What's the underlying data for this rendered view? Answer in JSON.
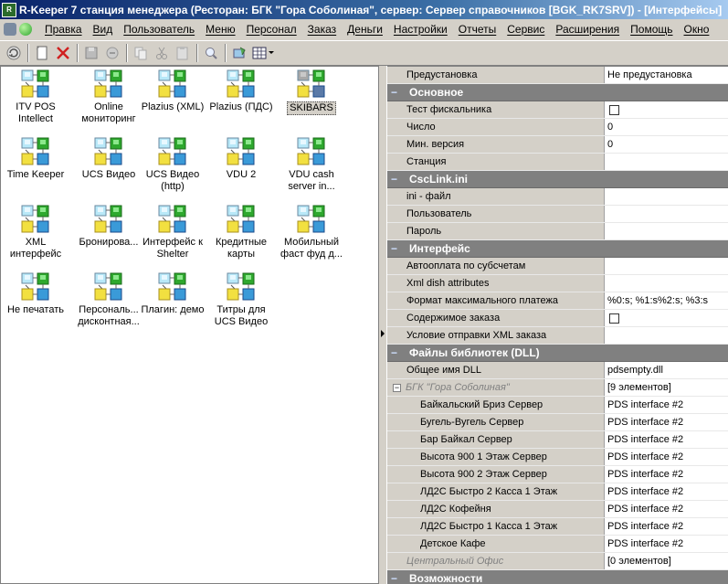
{
  "window": {
    "title": "R-Keeper 7 станция менеджера (Ресторан: БГК \"Гора Соболиная\", сервер: Сервер справочников [BGK_RK7SRV]) - [Интерфейсы]"
  },
  "menu": [
    "Правка",
    "Вид",
    "Пользователь",
    "Меню",
    "Персонал",
    "Заказ",
    "Деньги",
    "Настройки",
    "Отчеты",
    "Сервис",
    "Расширения",
    "Помощь",
    "Окно"
  ],
  "toolbar": {
    "buttons": [
      "refresh-icon",
      "new-document-icon",
      "delete-icon",
      "save-icon",
      "undo-icon",
      "copy-icon",
      "cut-icon",
      "paste-icon",
      "search-icon",
      "properties-icon",
      "grid-view-icon"
    ]
  },
  "interfaces": [
    {
      "label": "ITV POS Intellect"
    },
    {
      "label": "Online мониторинг"
    },
    {
      "label": "Plazius (XML)"
    },
    {
      "label": "Plazius (ПДС)"
    },
    {
      "label": "SKIBARS",
      "selected": true
    },
    {
      "label": "Time Keeper"
    },
    {
      "label": "UCS Видео"
    },
    {
      "label": "UCS Видео (http)"
    },
    {
      "label": "VDU 2"
    },
    {
      "label": "VDU cash server in..."
    },
    {
      "label": "XML интерфейс"
    },
    {
      "label": "Бронирова..."
    },
    {
      "label": "Интерфейс к Shelter"
    },
    {
      "label": "Кредитные карты"
    },
    {
      "label": "Мобильный фаст фуд д..."
    },
    {
      "label": "Не печатать"
    },
    {
      "label": "Персональ... дисконтная..."
    },
    {
      "label": "Плагин: демо"
    },
    {
      "label": "Титры для UCS Видео"
    }
  ],
  "properties": [
    {
      "kind": "prop",
      "name": "Предустановка",
      "value": "Не предустановка"
    },
    {
      "kind": "cat",
      "name": "Основное"
    },
    {
      "kind": "prop",
      "name": "Тест фискальника",
      "checkbox": true
    },
    {
      "kind": "prop",
      "name": "Число",
      "value": "0"
    },
    {
      "kind": "prop",
      "name": "Мин. версия",
      "value": "0"
    },
    {
      "kind": "prop",
      "name": "Станция",
      "value": ""
    },
    {
      "kind": "cat",
      "name": "CscLink.ini"
    },
    {
      "kind": "prop",
      "name": "ini - файл",
      "value": ""
    },
    {
      "kind": "prop",
      "name": "Пользователь",
      "value": ""
    },
    {
      "kind": "prop",
      "name": "Пароль",
      "value": ""
    },
    {
      "kind": "cat",
      "name": "Интерфейс"
    },
    {
      "kind": "prop",
      "name": "Автооплата по субсчетам",
      "value": ""
    },
    {
      "kind": "prop",
      "name": "Xml dish attributes",
      "value": ""
    },
    {
      "kind": "prop",
      "name": "Формат максимального платежа",
      "value": "%0:s; %1:s%2:s; %3:s"
    },
    {
      "kind": "prop",
      "name": "Содержимое заказа",
      "checkbox": true
    },
    {
      "kind": "prop",
      "name": "Условие отправки XML заказа",
      "value": ""
    },
    {
      "kind": "cat",
      "name": "Файлы библиотек (DLL)"
    },
    {
      "kind": "prop",
      "name": "Общее имя DLL",
      "value": "pdsempty.dll"
    },
    {
      "kind": "group",
      "name": "БГК \"Гора Соболиная\"",
      "value": "[9 элементов]"
    },
    {
      "kind": "sub",
      "name": "Байкальский Бриз Сервер",
      "value": "PDS interface #2"
    },
    {
      "kind": "sub",
      "name": "Бугель-Вугель Сервер",
      "value": "PDS interface #2"
    },
    {
      "kind": "sub",
      "name": "Бар Байкал Сервер",
      "value": "PDS interface #2"
    },
    {
      "kind": "sub",
      "name": "Высота 900 1 Этаж Сервер",
      "value": "PDS interface #2"
    },
    {
      "kind": "sub",
      "name": "Высота 900 2 Этаж Сервер",
      "value": "PDS interface #2"
    },
    {
      "kind": "sub",
      "name": "ЛД2С Быстро 2 Касса 1 Этаж",
      "value": "PDS interface #2"
    },
    {
      "kind": "sub",
      "name": "ЛД2С Кофейня",
      "value": "PDS interface #2"
    },
    {
      "kind": "sub",
      "name": "ЛД2С Быстро 1 Касса 1 Этаж",
      "value": "PDS interface #2"
    },
    {
      "kind": "sub",
      "name": "Детское Кафе",
      "value": "PDS interface #2"
    },
    {
      "kind": "group2",
      "name": "Центральный Офис",
      "value": "[0 элементов]"
    },
    {
      "kind": "cat",
      "name": "Возможности"
    }
  ]
}
